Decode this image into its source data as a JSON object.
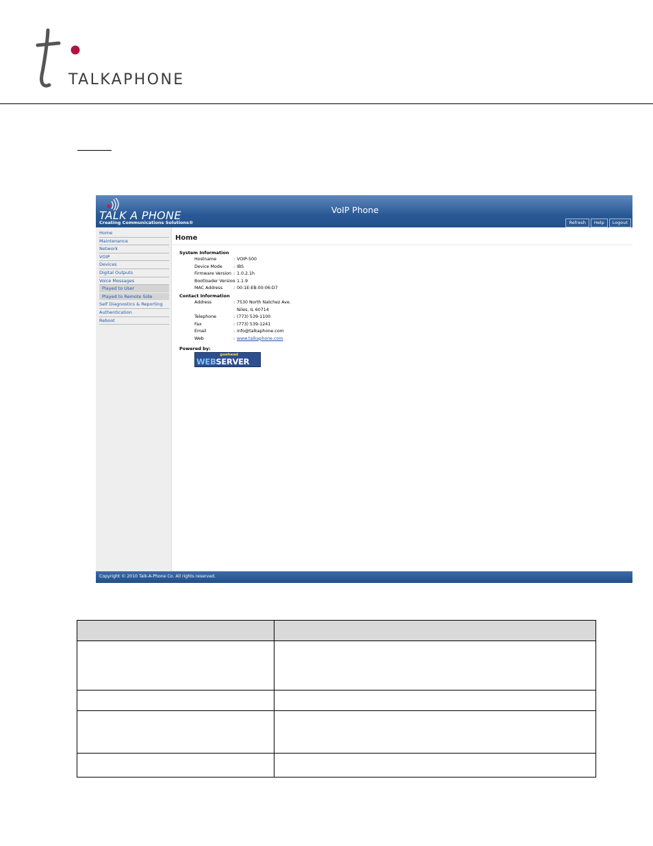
{
  "document": {
    "logo_wordmark": "TALKAPHONE"
  },
  "ui": {
    "brand": {
      "name": "TALK A PHONE",
      "tagline": "Creating Communications Solutions®"
    },
    "window_title": "VoIP Phone",
    "toolbar": {
      "refresh_label": "Refresh",
      "help_label": "Help",
      "logout_label": "Logout"
    },
    "sidebar": {
      "items": [
        {
          "label": "Home"
        },
        {
          "label": "Maintenance"
        },
        {
          "label": "Network"
        },
        {
          "label": "VOIP"
        },
        {
          "label": "Devices"
        },
        {
          "label": "Digital Outputs"
        },
        {
          "label": "Voice Messages"
        },
        {
          "label": "Played to User"
        },
        {
          "label": "Played to Remote Side"
        },
        {
          "label": "Self Diagnostics & Reporting"
        },
        {
          "label": "Authentication"
        },
        {
          "label": "Reboot"
        }
      ]
    },
    "page_title": "Home",
    "system_info": {
      "heading": "System Information",
      "rows": [
        {
          "key": "Hostname",
          "value": "VOIP-500"
        },
        {
          "key": "Device Mode",
          "value": "IBS"
        },
        {
          "key": "Firmware Version",
          "value": "1.0.2.1h"
        },
        {
          "key": "Bootloader Version",
          "value": "1.1.9"
        },
        {
          "key": "MAC Address",
          "value": "00:1E:EB:00:06:D7"
        }
      ]
    },
    "contact_info": {
      "heading": "Contact Information",
      "address_key": "Address",
      "address_line1": "7530 North Natchez Ave.",
      "address_line2": "Niles, IL 60714",
      "rows": [
        {
          "key": "Telephone",
          "value": "(773) 539-1100"
        },
        {
          "key": "Fax",
          "value": "(773) 539-1241"
        },
        {
          "key": "Email",
          "value": "info@talkaphone.com"
        }
      ],
      "web_key": "Web",
      "web_value": "www.talkaphone.com"
    },
    "powered_by": "Powered by:",
    "badge": {
      "top": "goahead",
      "word1": "WEB",
      "word2": "SERVER"
    },
    "separator": ":",
    "footer": "Copyright © 2010 Talk-A-Phone Co. All rights reserved."
  }
}
